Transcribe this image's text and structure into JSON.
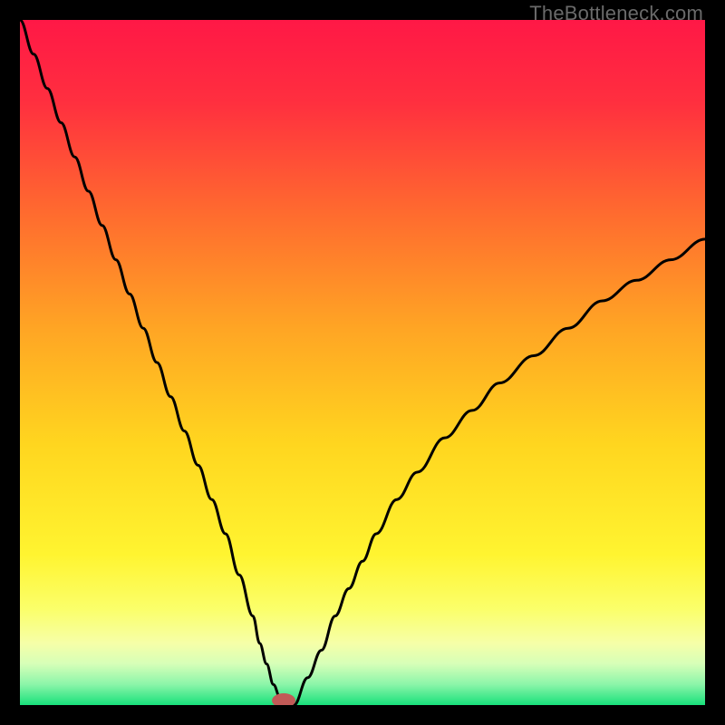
{
  "watermark": "TheBottleneck.com",
  "chart_data": {
    "type": "line",
    "title": "",
    "xlabel": "",
    "ylabel": "",
    "xlim": [
      0,
      100
    ],
    "ylim": [
      0,
      100
    ],
    "x": [
      0,
      2,
      4,
      6,
      8,
      10,
      12,
      14,
      16,
      18,
      20,
      22,
      24,
      26,
      28,
      30,
      32,
      34,
      35,
      36,
      37,
      38,
      39,
      40,
      42,
      44,
      46,
      48,
      50,
      52,
      55,
      58,
      62,
      66,
      70,
      75,
      80,
      85,
      90,
      95,
      100
    ],
    "values": [
      100,
      95,
      90,
      85,
      80,
      75,
      70,
      65,
      60,
      55,
      50,
      45,
      40,
      35,
      30,
      25,
      19,
      13,
      9,
      6,
      3,
      1,
      0,
      0,
      4,
      8,
      13,
      17,
      21,
      25,
      30,
      34,
      39,
      43,
      47,
      51,
      55,
      59,
      62,
      65,
      68
    ],
    "marker": {
      "x": 38.5,
      "y": 0
    },
    "gradient_stops": [
      {
        "offset": 0.0,
        "color": "#ff1846"
      },
      {
        "offset": 0.12,
        "color": "#ff2f3f"
      },
      {
        "offset": 0.28,
        "color": "#ff6a2f"
      },
      {
        "offset": 0.45,
        "color": "#ffa524"
      },
      {
        "offset": 0.62,
        "color": "#ffd61f"
      },
      {
        "offset": 0.78,
        "color": "#fff430"
      },
      {
        "offset": 0.86,
        "color": "#fbff6a"
      },
      {
        "offset": 0.91,
        "color": "#f6ffa8"
      },
      {
        "offset": 0.94,
        "color": "#d6ffb8"
      },
      {
        "offset": 0.97,
        "color": "#8bf5a9"
      },
      {
        "offset": 1.0,
        "color": "#18e07b"
      }
    ],
    "curve_color": "#000000",
    "marker_color": "#c15a57"
  }
}
